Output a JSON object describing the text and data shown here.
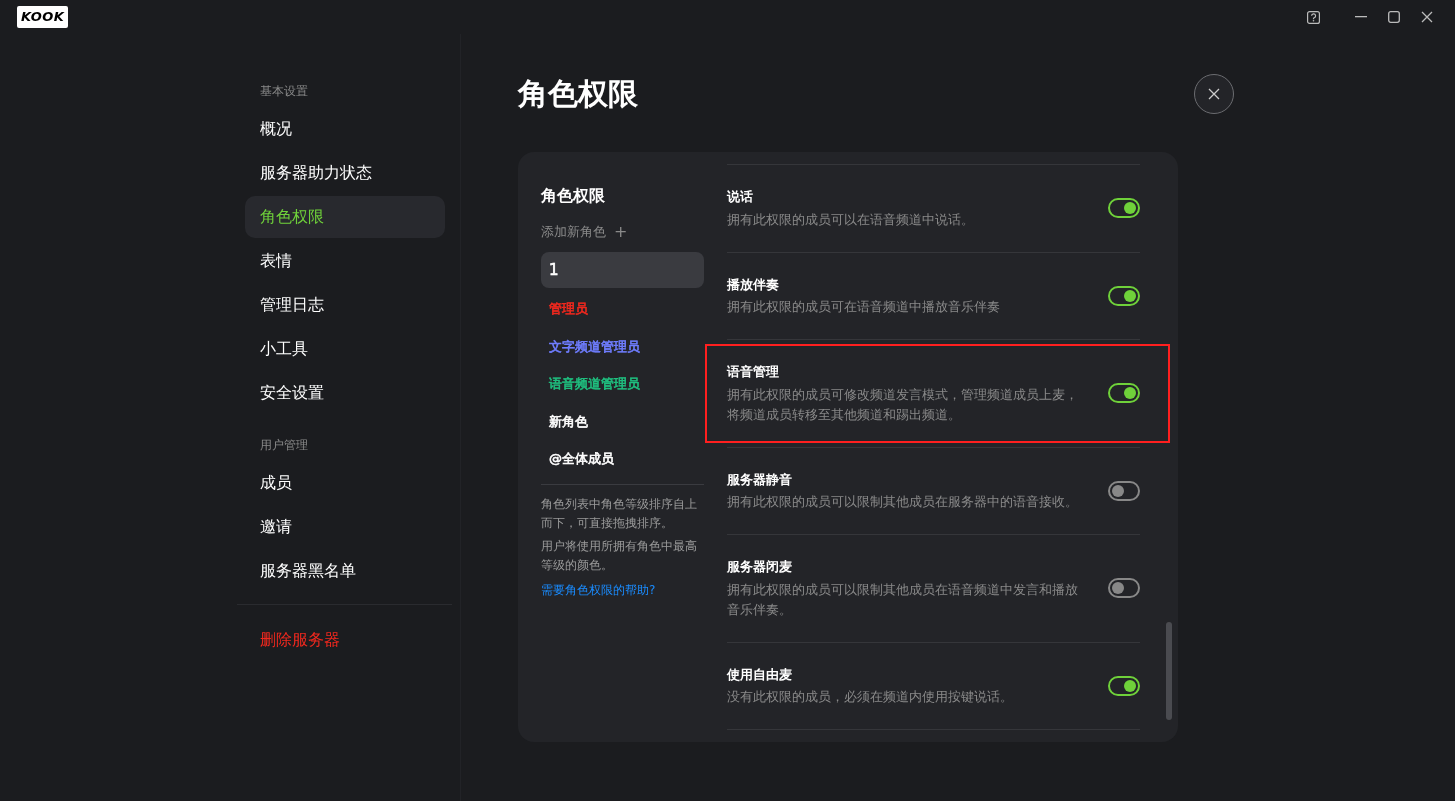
{
  "app": {
    "logo": "KOOK"
  },
  "sidebar": {
    "groups": [
      {
        "heading": "基本设置",
        "items": [
          {
            "label": "概况",
            "selected": false,
            "kind": "normal"
          },
          {
            "label": "服务器助力状态",
            "selected": false,
            "kind": "normal"
          },
          {
            "label": "角色权限",
            "selected": true,
            "kind": "normal"
          },
          {
            "label": "表情",
            "selected": false,
            "kind": "normal"
          },
          {
            "label": "管理日志",
            "selected": false,
            "kind": "normal"
          },
          {
            "label": "小工具",
            "selected": false,
            "kind": "normal"
          },
          {
            "label": "安全设置",
            "selected": false,
            "kind": "normal"
          }
        ]
      },
      {
        "heading": "用户管理",
        "items": [
          {
            "label": "成员",
            "selected": false,
            "kind": "normal"
          },
          {
            "label": "邀请",
            "selected": false,
            "kind": "normal"
          },
          {
            "label": "服务器黑名单",
            "selected": false,
            "kind": "normal"
          }
        ]
      },
      {
        "items": [
          {
            "label": "删除服务器",
            "selected": false,
            "kind": "danger"
          }
        ]
      }
    ]
  },
  "page": {
    "title": "角色权限"
  },
  "roles_panel": {
    "title": "角色权限",
    "add_role": "添加新角色",
    "add_icon": "+",
    "roles": [
      {
        "name": "1",
        "selected": true,
        "color": "#ffffff"
      },
      {
        "name": "管理员",
        "selected": false,
        "color": "#f0281e"
      },
      {
        "name": "文字频道管理员",
        "selected": false,
        "color": "#6f7dff"
      },
      {
        "name": "语音频道管理员",
        "selected": false,
        "color": "#1fbf7f"
      },
      {
        "name": "新角色",
        "selected": false,
        "color": "#ffffff"
      },
      {
        "name": "@全体成员",
        "selected": false,
        "color": "#ffffff"
      }
    ],
    "notes": [
      "角色列表中角色等级排序自上而下，可直接拖拽排序。",
      "用户将使用所拥有角色中最高等级的颜色。"
    ],
    "help_link": "需要角色权限的帮助?"
  },
  "permissions": [
    {
      "title": "说话",
      "description": "拥有此权限的成员可以在语音频道中说话。",
      "on": true,
      "highlighted": false
    },
    {
      "title": "播放伴奏",
      "description": "拥有此权限的成员可在语音频道中播放音乐伴奏",
      "on": true,
      "highlighted": false
    },
    {
      "title": "语音管理",
      "description": "拥有此权限的成员可修改频道发言模式，管理频道成员上麦，将频道成员转移至其他频道和踢出频道。",
      "on": true,
      "highlighted": true
    },
    {
      "title": "服务器静音",
      "description": "拥有此权限的成员可以限制其他成员在服务器中的语音接收。",
      "on": false,
      "highlighted": false
    },
    {
      "title": "服务器闭麦",
      "description": "拥有此权限的成员可以限制其他成员在语音频道中发言和播放音乐伴奏。",
      "on": false,
      "highlighted": false
    },
    {
      "title": "使用自由麦",
      "description": "没有此权限的成员，必须在频道内使用按键说话。",
      "on": true,
      "highlighted": false
    }
  ]
}
